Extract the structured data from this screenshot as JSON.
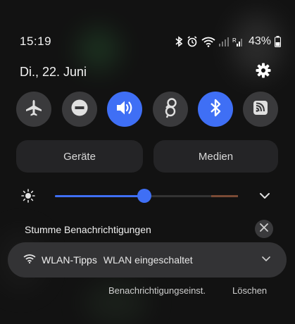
{
  "status": {
    "time": "15:19",
    "battery_percent": "43%",
    "icons": [
      "bluetooth-icon",
      "alarm-icon",
      "wifi-icon",
      "signal-icon",
      "signal-r-icon",
      "battery-icon"
    ]
  },
  "header": {
    "date": "Di., 22. Juni",
    "settings_icon": "gear-icon"
  },
  "quick_toggles": [
    {
      "name": "airplane-mode",
      "icon": "airplane-icon",
      "active": false
    },
    {
      "name": "do-not-disturb",
      "icon": "minus-circle-icon",
      "active": false
    },
    {
      "name": "sound",
      "icon": "volume-icon",
      "active": true
    },
    {
      "name": "vpn",
      "icon": "vpn-icon",
      "active": false
    },
    {
      "name": "bluetooth",
      "icon": "bluetooth-icon",
      "active": true
    },
    {
      "name": "nfc",
      "icon": "nfc-icon",
      "active": false
    }
  ],
  "buttons": {
    "devices": "Geräte",
    "media": "Medien"
  },
  "brightness": {
    "level": 0.49
  },
  "notifications": {
    "section_title": "Stumme Benachrichtigungen",
    "items": [
      {
        "app": "WLAN-Tipps",
        "text": "WLAN eingeschaltet",
        "icon": "wifi-icon"
      }
    ]
  },
  "actions": {
    "settings": "Benachrichtigungseinst.",
    "clear": "Löschen"
  },
  "colors": {
    "accent": "#3f6ff5",
    "toggle_off": "#3a3a3c",
    "background": "#121212"
  }
}
